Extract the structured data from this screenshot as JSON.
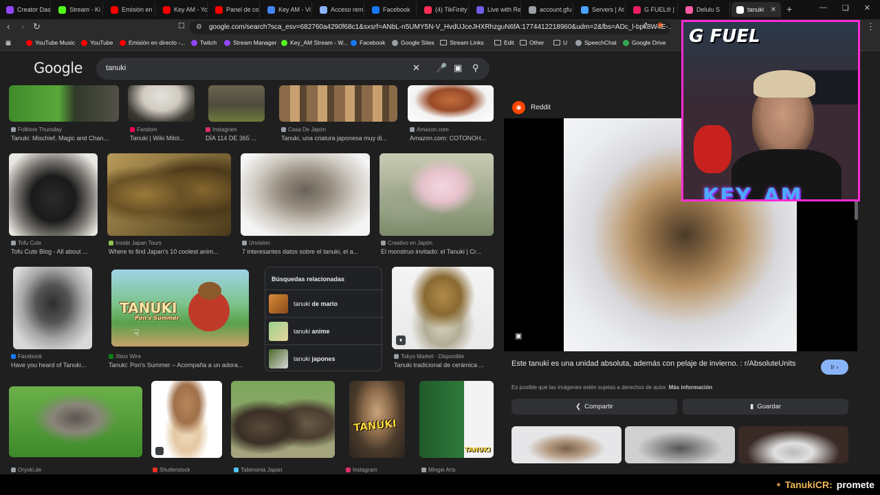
{
  "tabs": [
    {
      "label": "Creator Das",
      "color": "#9146ff"
    },
    {
      "label": "Stream - Ki",
      "color": "#53fc18"
    },
    {
      "label": "Emisión en",
      "color": "#ff0000"
    },
    {
      "label": "Key AM - Yo",
      "color": "#ff0000"
    },
    {
      "label": "Panel de co",
      "color": "#ff0000"
    },
    {
      "label": "Key AM - Vi",
      "color": "#4285f4"
    },
    {
      "label": "Acceso rem",
      "color": "#8ab4f8"
    },
    {
      "label": "Facebook",
      "color": "#1877f2"
    },
    {
      "label": "(4) TikFinity",
      "color": "#ff2d55"
    },
    {
      "label": "Live with Re",
      "color": "#6c5ce7"
    },
    {
      "label": "account.gfu",
      "color": "#9aa0a6"
    },
    {
      "label": "Servers | At",
      "color": "#4aa3ff"
    },
    {
      "label": "G FUEL® |",
      "color": "#e91e63"
    },
    {
      "label": "Delulu S",
      "color": "#ff5aa5"
    },
    {
      "label": "tanuki",
      "color": "#ffffff",
      "active": true
    }
  ],
  "address_bar": {
    "url": "google.com/search?sca_esv=682760a4290f68c1&sxsrf=ANbL-n5UMY5N-V_HvdUJceJHXRhzguN6fA:1774412218960&udm=2&fbs=ADc_l-bpk8W4E-..."
  },
  "bookmarks": [
    {
      "label": "YouTube Music",
      "color": "#ff0000"
    },
    {
      "label": "YouTube",
      "color": "#ff0000"
    },
    {
      "label": "Emisión en directo -...",
      "color": "#ff0000"
    },
    {
      "label": "Twitch",
      "color": "#9146ff"
    },
    {
      "label": "Stream Manager",
      "color": "#9146ff"
    },
    {
      "label": "Key_AM Stream - W...",
      "color": "#53fc18"
    },
    {
      "label": "Facebook",
      "color": "#1877f2"
    },
    {
      "label": "Google Sites",
      "color": "#9aa0a6"
    },
    {
      "label": "Stream Links",
      "color": "folder"
    },
    {
      "label": "Edit",
      "color": "folder"
    },
    {
      "label": "Other",
      "color": "folder"
    },
    {
      "label": "U",
      "color": "folder"
    },
    {
      "label": "SpeechChat",
      "color": "#9aa0a6"
    },
    {
      "label": "Google Drive",
      "color": "#34a853"
    }
  ],
  "google": {
    "logo": "Google",
    "query": "tanuki"
  },
  "results": [
    {
      "source": "Folklore Thursday",
      "title": "Tanuki: Mischief, Magic and Chan...",
      "color": "#9aa0a6"
    },
    {
      "source": "Fandom",
      "title": "Tanuki | Wiki Mitol...",
      "color": "#fa005a"
    },
    {
      "source": "Instagram",
      "title": "DÍA 114 DE 365 ...",
      "color": "#e1306c"
    },
    {
      "source": "Casa De Japón",
      "title": "Tanuki, una criatura japonesa muy di...",
      "color": "#9aa0a6"
    },
    {
      "source": "Amazon.com",
      "title": "Amazon.com: COTONOH...",
      "color": "#9aa0a6"
    },
    {
      "source": "Tofu Cute",
      "title": "Tofu Cute Blog - All about ...",
      "color": "#9aa0a6"
    },
    {
      "source": "Inside Japan Tours",
      "title": "Where to find Japan's 10 coolest anim...",
      "color": "#8bc34a"
    },
    {
      "source": "Unvision",
      "title": "7 interesantes datos sobre el tanuki, el a...",
      "color": "#9aa0a6"
    },
    {
      "source": "Creativo en Japón",
      "title": "El monstruo invitado: el Tanuki | Cr...",
      "color": "#9aa0a6"
    },
    {
      "source": "Facebook",
      "title": "Have you heard of Tanuki...",
      "color": "#1877f2"
    },
    {
      "source": "Xbox Wire",
      "title": "Tanuki: Pon's Summer – Acompaña a un adora...",
      "color": "#107c10"
    },
    {
      "source": "Tokyo Market · Disponible",
      "title": "Tanuki tradicional de cerámica ...",
      "color": "#9aa0a6"
    },
    {
      "source": "Oryoki.de",
      "title": "",
      "color": "#9aa0a6"
    },
    {
      "source": "Shutterstock",
      "title": "",
      "color": "#ee2b24"
    },
    {
      "source": "Tabimonia Japan",
      "title": "",
      "color": "#4fc3f7"
    },
    {
      "source": "Instagram",
      "title": "",
      "color": "#e1306c"
    },
    {
      "source": "Mingei Arts",
      "title": "",
      "color": "#9aa0a6"
    }
  ],
  "thumb_text": {
    "tanuki_game": "TANUKI",
    "tanuki_game_sub": "Pon's Summer",
    "tanuki_photo": "TANUKI",
    "tanuki_card": "TANUKI"
  },
  "related": {
    "title": "Búsquedas relacionadas",
    "items": [
      {
        "prefix": "tanuki ",
        "suffix": "de mario"
      },
      {
        "prefix": "tanuki ",
        "suffix": "anime"
      },
      {
        "prefix": "tanuki ",
        "suffix": "japones"
      }
    ]
  },
  "preview": {
    "source": "Reddit",
    "caption": "Este tanuki es una unidad absoluta, además con pelaje de invierno. : r/AbsoluteUnits",
    "copyright": "Es posible que las imágenes estén sujetas a derechos de autor.",
    "copyright_link": "Más información",
    "visit": "Ir",
    "share": "Compartir",
    "save": "Guardar"
  },
  "overlay": {
    "brand": "G FUEL",
    "streamer": "KEY_AM"
  },
  "ticker": {
    "user": "TanukiCR:",
    "message": "promete"
  }
}
